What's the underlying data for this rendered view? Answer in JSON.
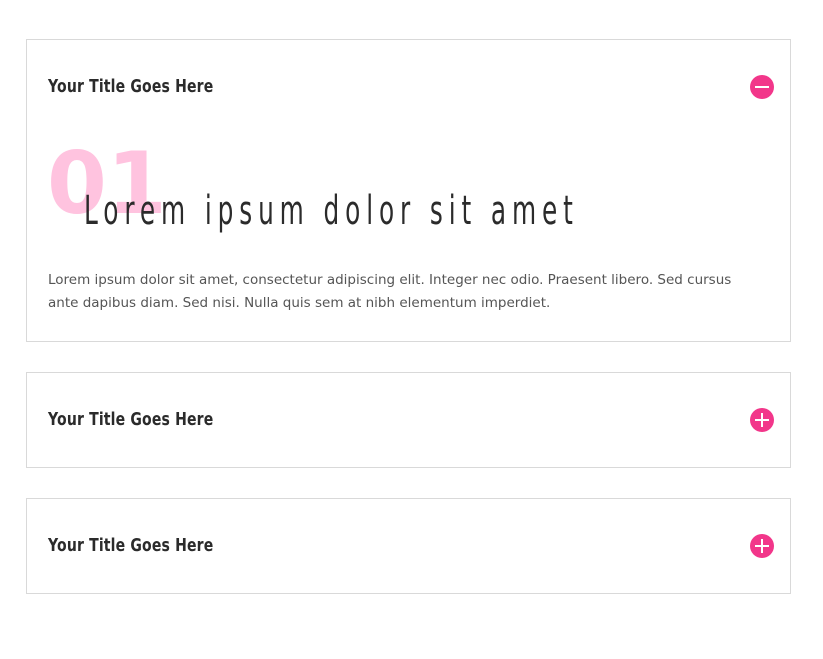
{
  "accordions": [
    {
      "title": "Your Title Goes Here",
      "state": "expanded",
      "toggle_icon": "minus-icon",
      "number": "01",
      "heading": "Lorem ipsum dolor sit amet",
      "body": "Lorem ipsum dolor sit amet, consectetur adipiscing elit. Integer nec odio. Praesent libero. Sed cursus ante dapibus diam. Sed nisi. Nulla quis sem at nibh elementum imperdiet."
    },
    {
      "title": "Your Title Goes Here",
      "state": "collapsed",
      "toggle_icon": "plus-icon"
    },
    {
      "title": "Your Title Goes Here",
      "state": "collapsed",
      "toggle_icon": "plus-icon"
    }
  ],
  "colors": {
    "accent": "#f2368a",
    "number": "#ffc3df",
    "title": "#2b2b2b",
    "body": "#555555",
    "border": "#d9d9d9"
  }
}
